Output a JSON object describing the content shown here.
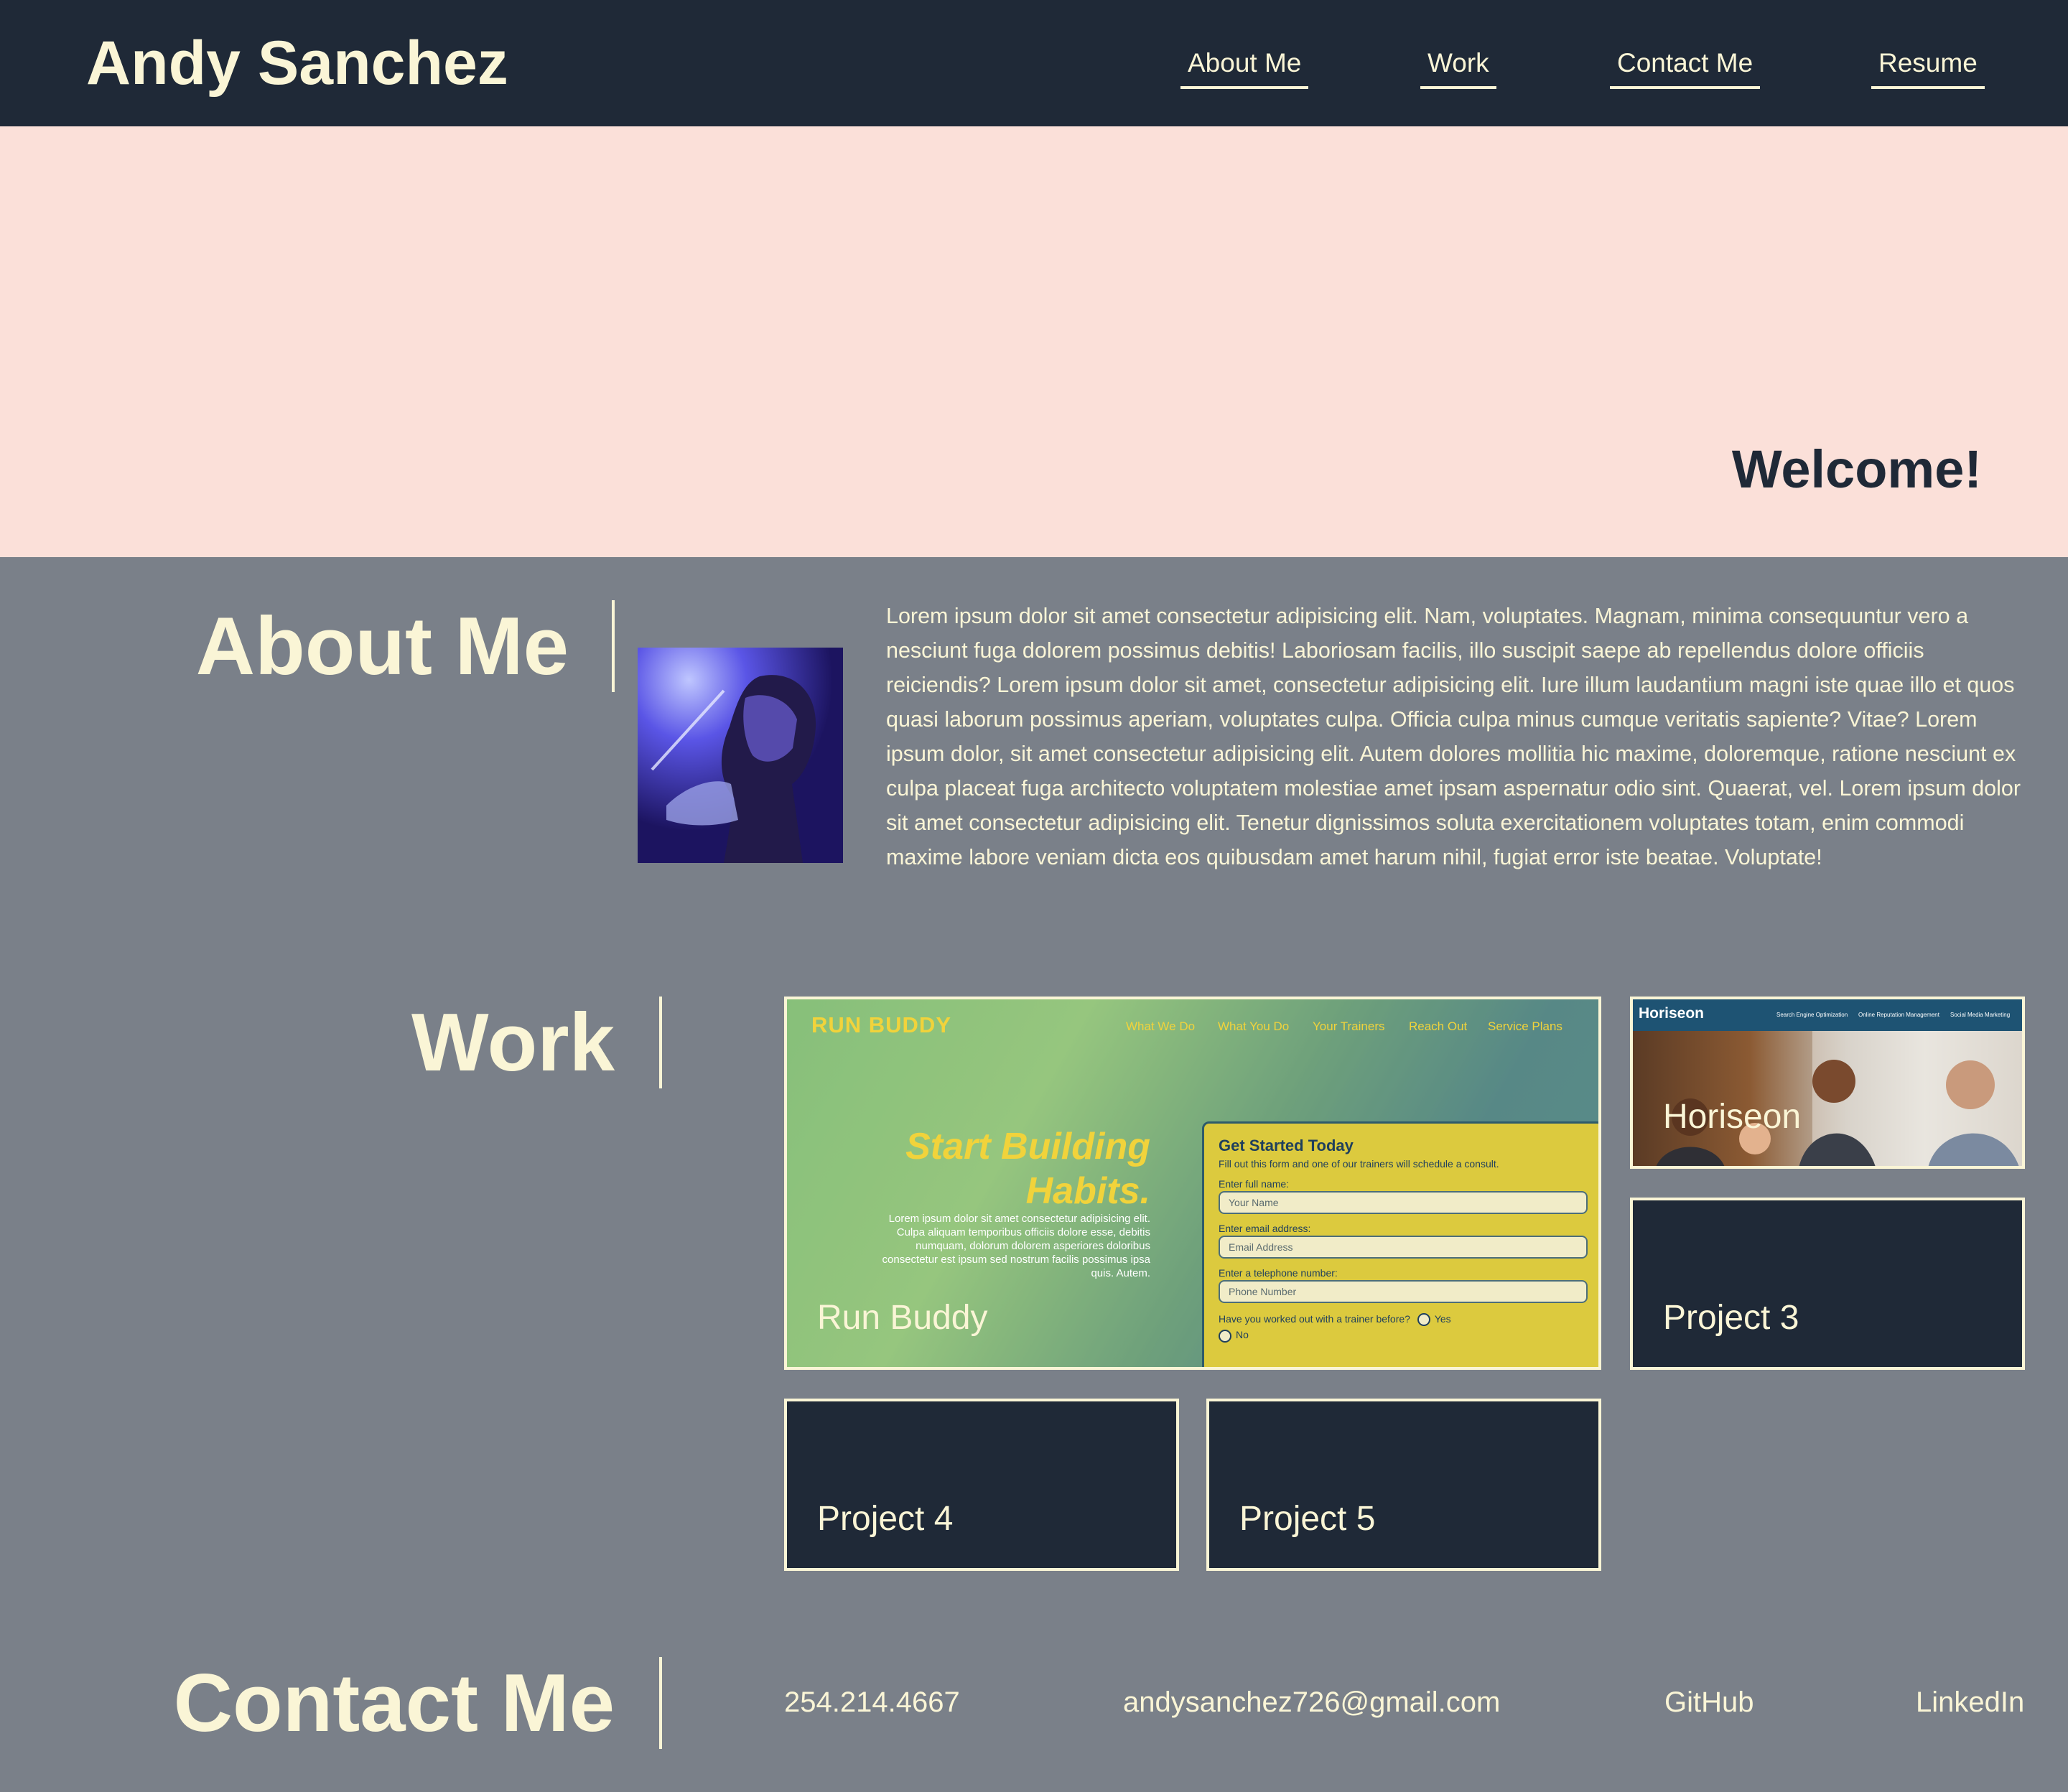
{
  "header": {
    "site_name": "Andy Sanchez",
    "nav": [
      "About Me",
      "Work",
      "Contact Me",
      "Resume"
    ]
  },
  "hero": {
    "welcome": "Welcome!"
  },
  "about": {
    "title": "About Me",
    "text": "Lorem ipsum dolor sit amet consectetur adipisicing elit. Nam, voluptates. Magnam, minima consequuntur vero a nesciunt fuga dolorem possimus debitis! Laboriosam facilis, illo suscipit saepe ab repellendus dolore officiis reiciendis? Lorem ipsum dolor sit amet, consectetur adipisicing elit. Iure illum laudantium magni iste quae illo et quos quasi laborum possimus aperiam, voluptates culpa. Officia culpa minus cumque veritatis sapiente? Vitae? Lorem ipsum dolor, sit amet consectetur adipisicing elit. Autem dolores mollitia hic maxime, doloremque, ratione nesciunt ex culpa placeat fuga architecto voluptatem molestiae amet ipsam aspernatur odio sint. Quaerat, vel. Lorem ipsum dolor sit amet consectetur adipisicing elit. Tenetur dignissimos soluta exercitationem voluptates totam, enim commodi maxime labore veniam dicta eos quibusdam amet harum nihil, fugiat error iste beatae. Voluptate!"
  },
  "work": {
    "title": "Work",
    "projects": [
      "Run Buddy",
      "Horiseon",
      "Project 3",
      "Project 4",
      "Project 5"
    ],
    "run_buddy_preview": {
      "brand": "RUN BUDDY",
      "nav": [
        "What We Do",
        "What You Do",
        "Your Trainers",
        "Reach Out",
        "Service Plans"
      ],
      "headline": "Start Building Habits.",
      "body": "Lorem ipsum dolor sit amet consectetur adipisicing elit. Culpa aliquam temporibus officiis dolore esse, debitis numquam, dolorum dolorem asperiores doloribus consectetur est ipsum sed nostrum facilis possimus ipsa quis. Autem.",
      "form_title": "Get Started Today",
      "form_sub": "Fill out this form and one of our trainers will schedule a consult.",
      "name_label": "Enter full name:",
      "name_placeholder": "Your Name",
      "email_label": "Enter email address:",
      "email_placeholder": "Email Address",
      "phone_label": "Enter a telephone number:",
      "phone_placeholder": "Phone Number",
      "question": "Have you worked out with a trainer before?",
      "yes": "Yes",
      "no": "No"
    },
    "horiseon_preview": {
      "brand": "Horiseon",
      "nav": [
        "Search Engine Optimization",
        "Online Reputation Management",
        "Social Media Marketing"
      ]
    }
  },
  "contact": {
    "title": "Contact Me",
    "phone": "254.214.4667",
    "email": "andysanchez726@gmail.com",
    "github": "GitHub",
    "linkedin": "LinkedIn"
  },
  "colors": {
    "header_bg": "#1f2937",
    "cream": "#faf5d6",
    "hero_bg": "#fbe0d9",
    "body_bg": "#7a8089"
  }
}
